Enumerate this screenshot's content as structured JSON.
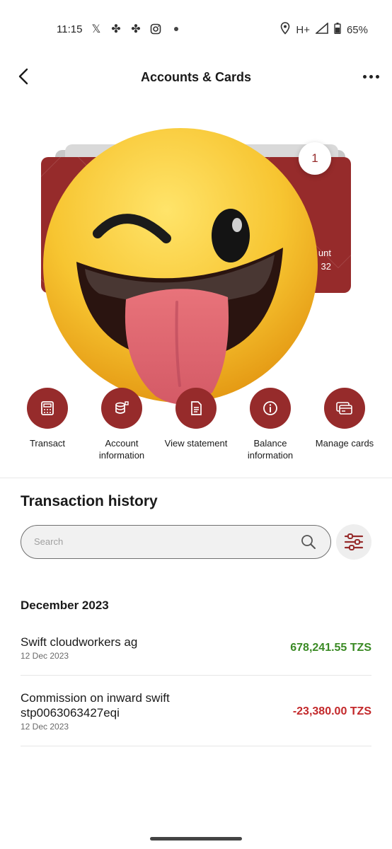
{
  "status_bar": {
    "time": "11:15",
    "network": "H+",
    "battery": "65%"
  },
  "header": {
    "title": "Accounts & Cards"
  },
  "card": {
    "count": "1",
    "partial_label": "unt",
    "partial_number": "32"
  },
  "actions": [
    {
      "label": "Transact",
      "icon": "calculator-icon"
    },
    {
      "label": "Account information",
      "icon": "coins-icon"
    },
    {
      "label": "View statement",
      "icon": "document-icon"
    },
    {
      "label": "Balance information",
      "icon": "info-icon"
    },
    {
      "label": "Manage cards",
      "icon": "cards-icon"
    }
  ],
  "history": {
    "title": "Transaction history",
    "search_placeholder": "Search",
    "month": "December 2023",
    "transactions": [
      {
        "title": "Swift cloudworkers ag",
        "date": "12 Dec 2023",
        "amount": "678,241.55 TZS",
        "type": "credit"
      },
      {
        "title": "Commission on inward swift stp0063063427eqi",
        "date": "12 Dec 2023",
        "amount": "-23,380.00 TZS",
        "type": "debit"
      }
    ]
  },
  "colors": {
    "brand": "#962b2b",
    "credit": "#3a8a24",
    "debit": "#c3282a"
  }
}
